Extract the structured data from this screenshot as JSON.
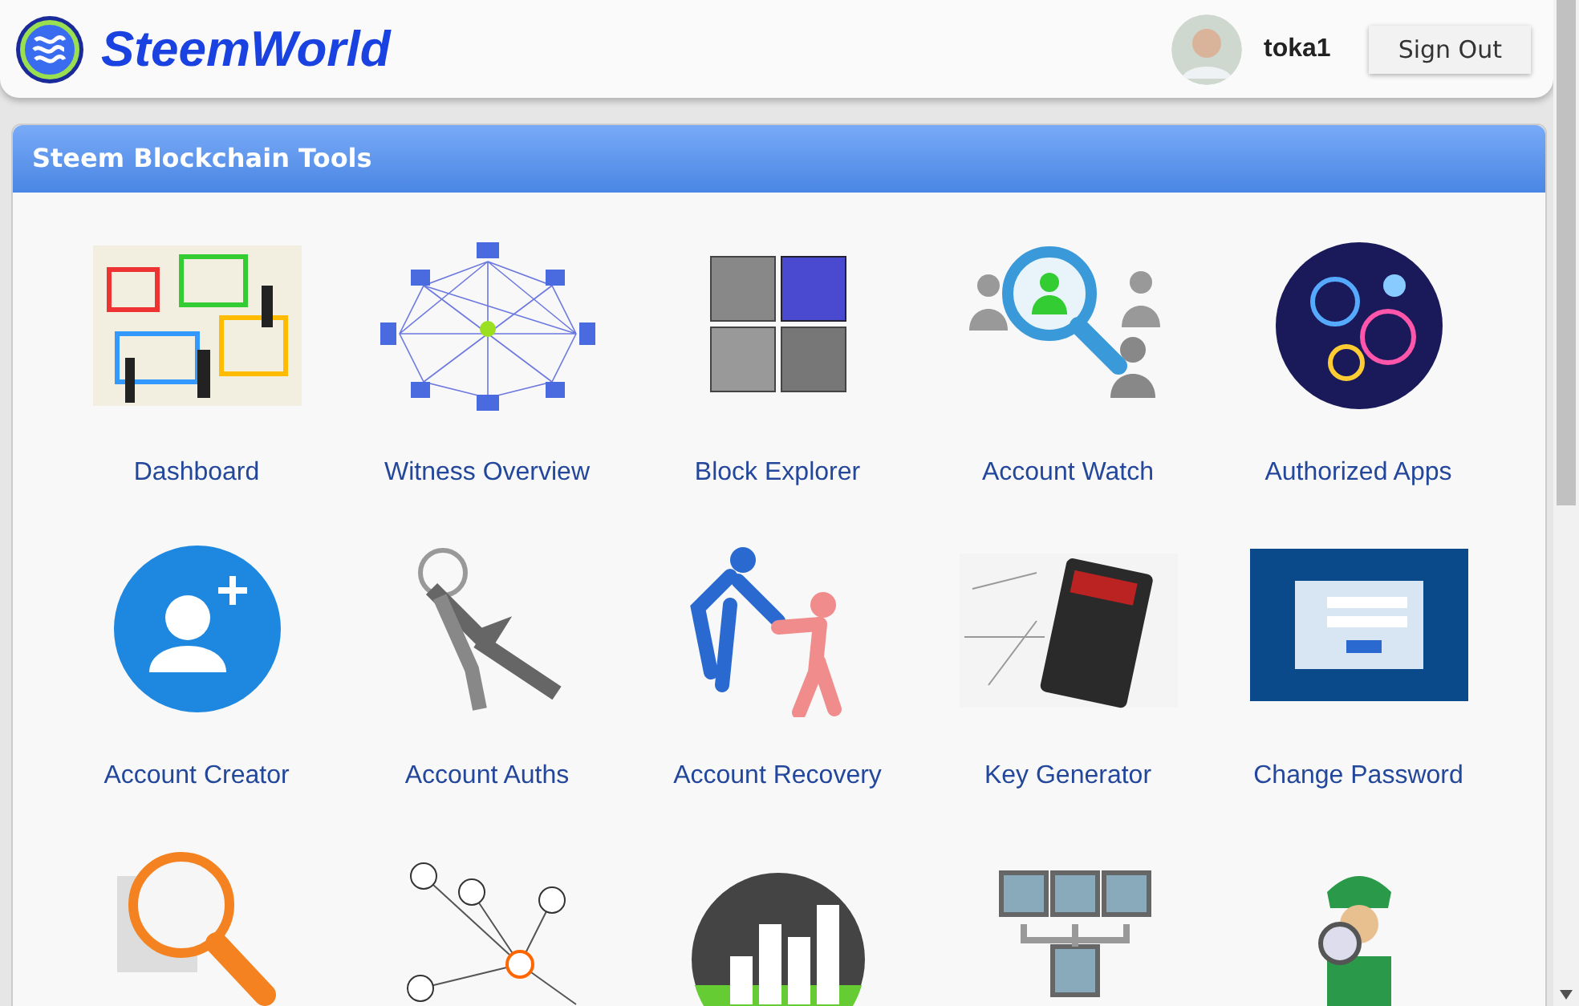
{
  "header": {
    "logo": "SteemWorld",
    "user": {
      "name": "toka1"
    },
    "sign_out": "Sign Out"
  },
  "panel": {
    "title": "Steem Blockchain Tools",
    "tools": [
      {
        "label": "Dashboard"
      },
      {
        "label": "Witness Overview"
      },
      {
        "label": "Block Explorer"
      },
      {
        "label": "Account Watch"
      },
      {
        "label": "Authorized Apps"
      },
      {
        "label": "Account Creator"
      },
      {
        "label": "Account Auths"
      },
      {
        "label": "Account Recovery"
      },
      {
        "label": "Key Generator"
      },
      {
        "label": "Change Password"
      }
    ]
  }
}
